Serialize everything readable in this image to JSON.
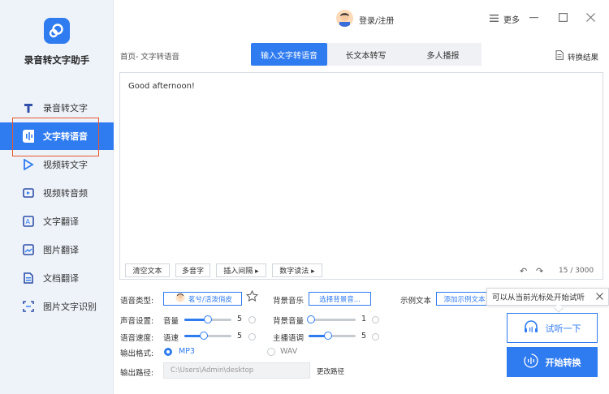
{
  "app": {
    "name": "录音转文字助手"
  },
  "sidebar": {
    "items": [
      {
        "label": "录音转文字",
        "icon": "t-icon"
      },
      {
        "label": "文字转语音",
        "icon": "waveform-icon",
        "active": true
      },
      {
        "label": "视频转文字",
        "icon": "video-text-icon"
      },
      {
        "label": "视频转音频",
        "icon": "video-audio-icon"
      },
      {
        "label": "文字翻译",
        "icon": "translate-icon"
      },
      {
        "label": "图片翻译",
        "icon": "image-translate-icon"
      },
      {
        "label": "文档翻译",
        "icon": "doc-translate-icon"
      },
      {
        "label": "图片文字识别",
        "icon": "scan-icon"
      }
    ]
  },
  "topbar": {
    "login": "登录/注册",
    "more": "更多"
  },
  "breadcrumb": "首页- 文字转语音",
  "tabs": [
    "输入文字转语音",
    "长文本转写",
    "多人播报"
  ],
  "result_label": "转换结果",
  "editor": {
    "text": "Good afternoon!",
    "buttons": [
      "清空文本",
      "多音字",
      "插入间隔 ▸",
      "数字读法 ▸"
    ],
    "count": "15 / 3000"
  },
  "settings": {
    "voice_type_label": "语音类型:",
    "voice_name": "茗兮/活泼俏皮",
    "bgm_label": "背景音乐",
    "bgm_button": "选择背景音...",
    "sample_label": "示例文本",
    "sample_button": "添加示例文本",
    "sound_label": "声音设置:",
    "volume_label": "音量",
    "volume_value": "5",
    "bg_volume_label": "背景音量",
    "bg_volume_value": "1",
    "speed_label": "语音速度:",
    "speed_sub": "语速",
    "speed_value": "5",
    "pitch_label": "主播语调",
    "pitch_value": "5",
    "format_label": "输出格式:",
    "format_options": [
      "MP3",
      "WAV"
    ],
    "format_selected": "MP3",
    "path_label": "输出路径:",
    "path_value": "C:\\Users\\Admin\\desktop",
    "change_path": "更改路径"
  },
  "tooltip": "可以从当前光标处开始试听",
  "actions": {
    "listen": "试听一下",
    "start": "开始转换"
  },
  "colors": {
    "accent": "#2f7bf0",
    "highlight_box": "#e8572f"
  }
}
